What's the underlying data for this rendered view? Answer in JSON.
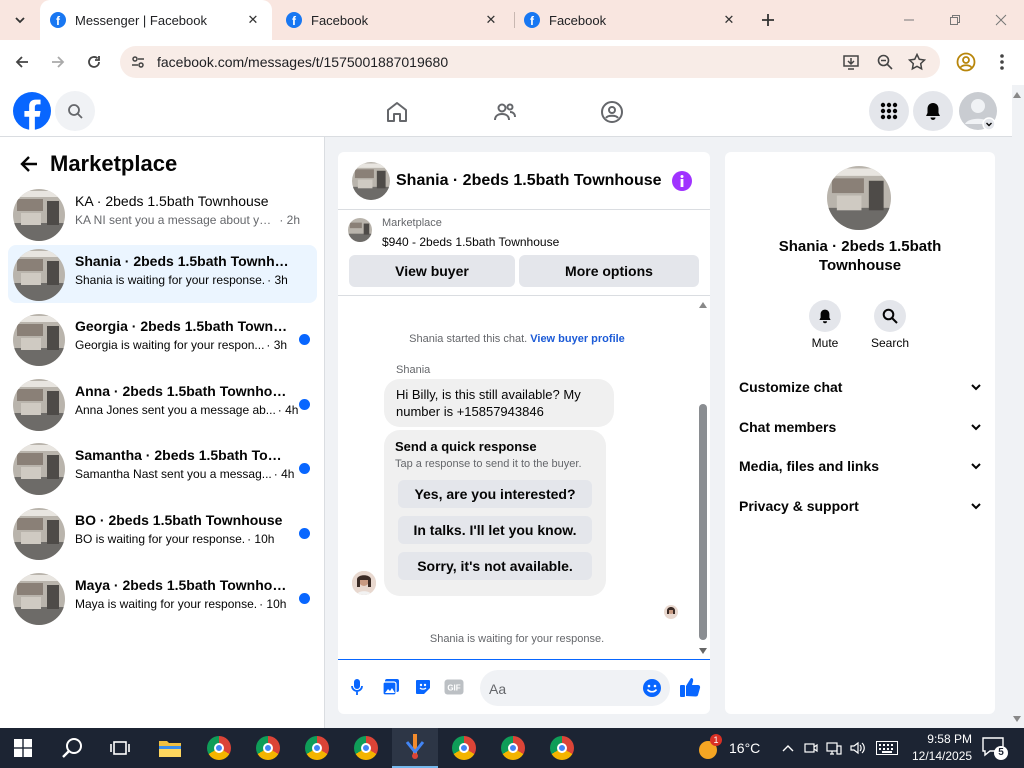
{
  "browser": {
    "tabs": [
      {
        "title": "Messenger | Facebook",
        "active": true
      },
      {
        "title": "Facebook",
        "active": false
      },
      {
        "title": "Facebook",
        "active": false
      }
    ],
    "url": "facebook.com/messages/t/1575001887019680"
  },
  "left": {
    "title": "Marketplace",
    "conversations": [
      {
        "name": "KA · 2beds 1.5bath Townhouse",
        "preview": "KA NI sent you a message about your...",
        "time": "· 2h",
        "unread": false,
        "selected": false
      },
      {
        "name": "Shania · 2beds 1.5bath Townhouse",
        "preview": "Shania is waiting for your response.",
        "time": "· 3h",
        "unread": true,
        "selected": true
      },
      {
        "name": "Georgia · 2beds 1.5bath Townho...",
        "preview": "Georgia is waiting for your respon...",
        "time": "· 3h",
        "unread": true,
        "selected": false
      },
      {
        "name": "Anna · 2beds 1.5bath Townhouse",
        "preview": "Anna Jones sent you a message ab...",
        "time": "· 4h",
        "unread": true,
        "selected": false
      },
      {
        "name": "Samantha · 2beds 1.5bath Townh...",
        "preview": "Samantha Nast sent you a messag...",
        "time": "· 4h",
        "unread": true,
        "selected": false
      },
      {
        "name": "BO · 2beds 1.5bath Townhouse",
        "preview": "BO is waiting for your response.",
        "time": "· 10h",
        "unread": true,
        "selected": false
      },
      {
        "name": "Maya · 2beds 1.5bath Townhouse",
        "preview": "Maya is waiting for your response.",
        "time": "· 10h",
        "unread": true,
        "selected": false
      }
    ]
  },
  "chat": {
    "title": "Shania · 2beds 1.5bath Townhouse",
    "listing_source": "Marketplace",
    "listing_title": "$940 - 2beds 1.5bath Townhouse",
    "view_buyer": "View buyer",
    "more_options": "More options",
    "started_text": "Shania started this chat.",
    "buyer_profile_link": "View buyer profile",
    "sender": "Shania",
    "message": "Hi Billy, is this still available? My number is +15857943846",
    "quick_title": "Send a quick response",
    "quick_sub": "Tap a response to send it to the buyer.",
    "quick_replies": [
      "Yes, are you interested?",
      "In talks. I'll let you know.",
      "Sorry, it's not available."
    ],
    "waiting": "Shania is waiting for your response.",
    "composer_placeholder": "Aa"
  },
  "right": {
    "title": "Shania · 2beds 1.5bath Townhouse",
    "mute": "Mute",
    "search": "Search",
    "sections": [
      "Customize chat",
      "Chat members",
      "Media, files and links",
      "Privacy & support"
    ]
  },
  "taskbar": {
    "weather": "16°C",
    "time": "9:58 PM",
    "date": "12/14/2025",
    "notifications": "5",
    "badge": "1"
  },
  "colors": {
    "fb_blue": "#0866ff",
    "unread_dot": "#0866ff",
    "info_purple": "#a033ff"
  }
}
